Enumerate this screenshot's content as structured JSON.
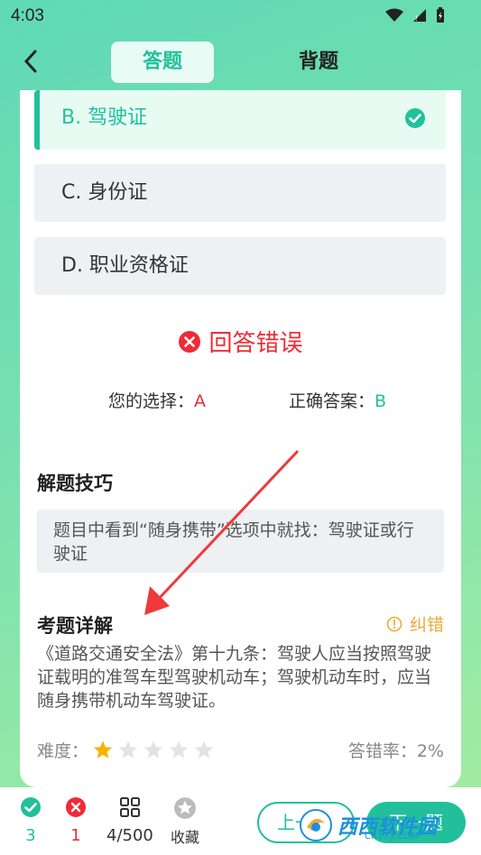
{
  "status": {
    "time": "4:03"
  },
  "tabs": {
    "answer": "答题",
    "memorize": "背题"
  },
  "options": [
    {
      "label": "B. 驾驶证",
      "state": "correct"
    },
    {
      "label": "C. 身份证"
    },
    {
      "label": "D. 职业资格证"
    }
  ],
  "result": {
    "text": "回答错误",
    "your_choice_label": "您的选择：",
    "your_choice": "A",
    "correct_label": "正确答案：",
    "correct": "B"
  },
  "tips": {
    "title": "解题技巧",
    "text": "题目中看到“随身携带”选项中就找：驾驶证或行驶证"
  },
  "detail": {
    "title": "考题详解",
    "correction": "纠错",
    "text": "《道路交通安全法》第十九条：驾驶人应当按照驾驶证载明的准驾车型驾驶机动车；驾驶机动车时，应当随身携带机动车驾驶证。"
  },
  "meta": {
    "difficulty_label": "难度：",
    "difficulty_rating": 1,
    "difficulty_max": 5,
    "error_rate": "答错率：2%"
  },
  "bottom": {
    "correct_count": "3",
    "wrong_count": "1",
    "progress": "4/500",
    "favorite": "收藏",
    "prev": "上一",
    "next": "下一题"
  },
  "watermark": {
    "text": "西西软件园",
    "sub": "CR173.COM"
  },
  "colors": {
    "accent": "#21c09a",
    "error": "#ef2b38",
    "warning": "#f0a93a",
    "star": "#f5b400"
  }
}
